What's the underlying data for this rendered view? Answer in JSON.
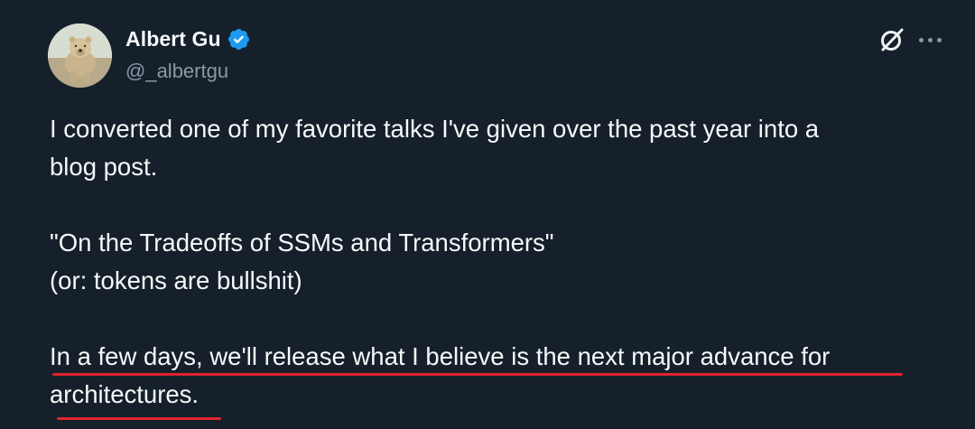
{
  "author": {
    "display_name": "Albert Gu",
    "handle": "@_albertgu",
    "verified": true,
    "verified_color": "#1d9bf0",
    "avatar_icon": "polar-bear-avatar"
  },
  "actions": {
    "grok_icon": "grok-icon",
    "more_icon": "more-horizontal-icon"
  },
  "tweet": {
    "line_1": "I converted one of my favorite talks I've given over the past year into a",
    "line_2": "blog post.",
    "line_3": "\"On the Tradeoffs of SSMs and Transformers\"",
    "line_4": "(or: tokens are bullshit)",
    "line_5": "In a few days, we'll release what I believe is the next major advance for",
    "line_6": "architectures."
  },
  "colors": {
    "background": "#15202b",
    "text": "#f7f9f9",
    "secondary_text": "#8b98a5",
    "annotation_underline": "#e0242f"
  }
}
